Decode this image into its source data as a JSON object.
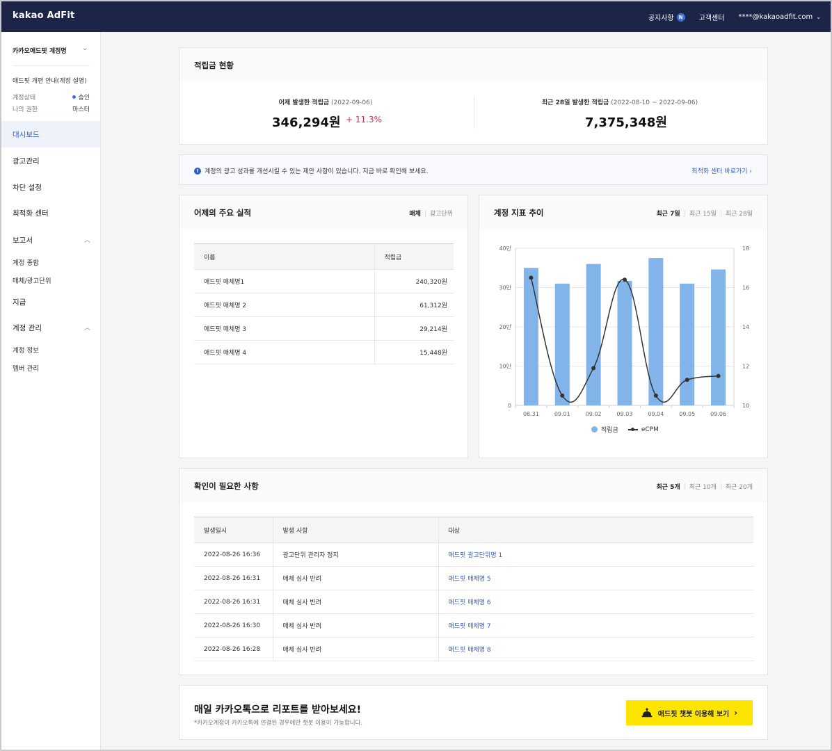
{
  "header": {
    "logo": "kakao AdFit",
    "notice_label": "공지사항",
    "notice_badge": "N",
    "support_label": "고객센터",
    "account_email": "****@kakaoadfit.com"
  },
  "sidebar": {
    "account_name": "카카오애드핏 계정명",
    "guide_link": "애드핏 개편 안내(계정 설명)",
    "status_label": "계정상태",
    "status_value": "승인",
    "role_label": "나의 권한",
    "role_value": "마스터",
    "menu": {
      "dashboard": "대시보드",
      "ads": "광고관리",
      "block": "차단 설정",
      "optimize": "최적화 센터",
      "reports": "보고서",
      "report_summary": "계정 종합",
      "report_media": "매체/광고단위",
      "payment": "지급",
      "account_mgmt": "계정 관리",
      "account_info": "계정 정보",
      "members": "멤버 관리"
    }
  },
  "earnings": {
    "title": "적립금 현황",
    "yesterday_label": "어제 발생한 적립금",
    "yesterday_date": "(2022-09-06)",
    "yesterday_value": "346,294원",
    "yesterday_delta": "+ 11.3%",
    "period_label": "최근 28일 발생한 적립금",
    "period_range": "(2022-08-10 ~ 2022-09-06)",
    "period_value": "7,375,348원"
  },
  "notice": {
    "icon": "info-icon",
    "text": "계정의 광고 성과를 개선시킬 수 있는 제안 사항이 있습니다. 지금 바로 확인해 보세요.",
    "link": "최적화 센터 바로가기 ›"
  },
  "performance": {
    "title": "어제의 주요 실적",
    "tab_media": "매체",
    "tab_unit": "광고단위",
    "col_name": "이름",
    "col_earnings": "적립금",
    "rows": [
      {
        "name": "애드핏 매체명1",
        "value": "240,320원"
      },
      {
        "name": "애드핏 매체명 2",
        "value": "61,312원"
      },
      {
        "name": "애드핏 매체명 3",
        "value": "29,214원"
      },
      {
        "name": "애드핏 매체명 4",
        "value": "15,448원"
      }
    ]
  },
  "trend": {
    "title": "계정 지표 추이",
    "tab_7": "최근 7일",
    "tab_15": "최근 15일",
    "tab_28": "최근 28일",
    "legend_bar": "적립금",
    "legend_line": "eCPM"
  },
  "chart_data": {
    "type": "bar",
    "categories": [
      "08.31",
      "09.01",
      "09.02",
      "09.03",
      "09.04",
      "09.05",
      "09.06"
    ],
    "series": [
      {
        "name": "적립금",
        "type": "bar",
        "axis": "left",
        "values": [
          350000,
          310000,
          360000,
          317000,
          375000,
          310000,
          346000
        ],
        "color": "#82b4ea"
      },
      {
        "name": "eCPM",
        "type": "line",
        "axis": "right",
        "values": [
          16.5,
          10.5,
          11.9,
          16.4,
          10.5,
          11.3,
          11.5
        ],
        "color": "#333333"
      }
    ],
    "left_axis": {
      "min": 0,
      "max": 400000,
      "ticks": [
        0,
        100000,
        200000,
        300000,
        400000
      ],
      "tick_labels": [
        "0",
        "10만",
        "20만",
        "30만",
        "40만"
      ]
    },
    "right_axis": {
      "min": 10,
      "max": 18,
      "ticks": [
        10,
        12,
        14,
        16,
        18
      ],
      "tick_labels": [
        "10",
        "12",
        "14",
        "16",
        "18"
      ]
    },
    "legend_position": "bottom"
  },
  "issues": {
    "title": "확인이 필요한 사항",
    "tab_5": "최근 5개",
    "tab_10": "최근 10개",
    "tab_20": "최근 20개",
    "col_date": "발생일시",
    "col_event": "발생 사항",
    "col_target": "대상",
    "rows": [
      {
        "date": "2022-08-26 16:36",
        "event": "광고단위 관리자 정지",
        "target": "애드핏 광고단위명 1"
      },
      {
        "date": "2022-08-26 16:31",
        "event": "매체 심사 반려",
        "target": "애드핏 매체명 5"
      },
      {
        "date": "2022-08-26 16:31",
        "event": "매체 심사 반려",
        "target": "애드핏 매체명 6"
      },
      {
        "date": "2022-08-26 16:30",
        "event": "매체 심사 반려",
        "target": "애드핏 매체명 7"
      },
      {
        "date": "2022-08-26 16:28",
        "event": "매체 심사 반려",
        "target": "애드핏 매체명 8"
      }
    ]
  },
  "promo": {
    "title": "매일 카카오톡으로 리포트를 받아보세요!",
    "subtitle": "*카카오계정이 카카오톡에 연결된 경우에만 챗봇 이용이 가능합니다.",
    "button": "애드핏 챗봇 이용해 보기",
    "button_color": "#fee500"
  }
}
